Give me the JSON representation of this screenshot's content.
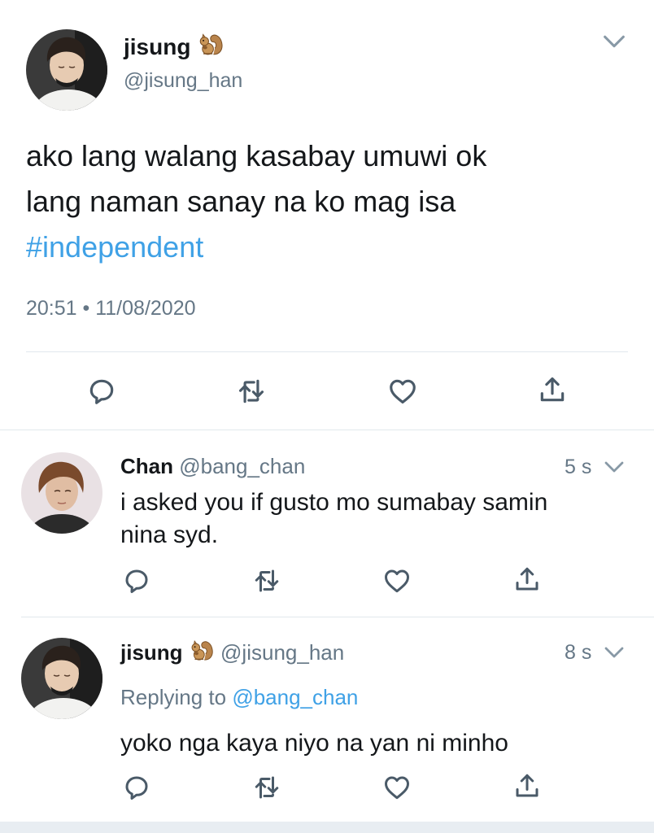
{
  "main_tweet": {
    "display_name": "jisung",
    "name_emoji": "squirrel-emoji",
    "handle": "@jisung_han",
    "text_line1": "ako lang walang kasabay umuwi ok",
    "text_line2": "lang naman sanay na ko mag isa",
    "hashtag": "#independent",
    "time": "20:51",
    "separator": "•",
    "date": "11/08/2020"
  },
  "replies": [
    {
      "display_name": "Chan",
      "handle": "@bang_chan",
      "age": "5 s",
      "text_line1": "i asked you if gusto mo sumabay samin",
      "text_line2": "nina syd."
    },
    {
      "display_name": "jisung",
      "name_emoji": "squirrel-emoji",
      "handle": "@jisung_han",
      "age": "8 s",
      "replying_prefix": "Replying to",
      "replying_to": "@bang_chan",
      "text_line1": "yoko nga kaya niyo na yan ni minho"
    }
  ],
  "icons": {
    "reply": "reply-icon",
    "retweet": "retweet-icon",
    "like": "heart-icon",
    "share": "share-icon",
    "menu": "chevron-down-icon"
  },
  "colors": {
    "link": "#3fa1e6",
    "muted": "#657786",
    "icon": "#4a5a68",
    "divider": "#e1e8ed"
  }
}
